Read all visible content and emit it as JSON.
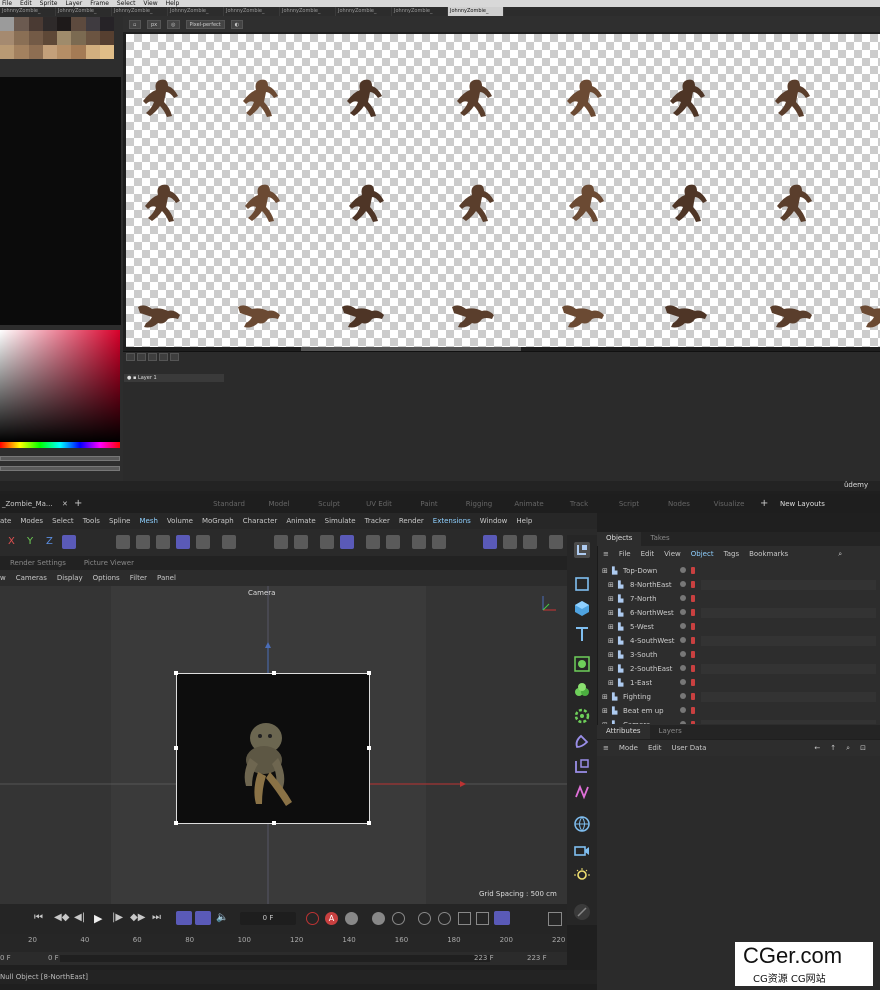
{
  "aseprite": {
    "menu": [
      "File",
      "Edit",
      "Sprite",
      "Layer",
      "Frame",
      "Select",
      "View",
      "Help"
    ],
    "tabs": [
      {
        "label": "JohnnyZombie_"
      },
      {
        "label": "JohnnyZombie_"
      },
      {
        "label": "JohnnyZombie_"
      },
      {
        "label": "JohnnyZombie_"
      },
      {
        "label": "JohnnyZombie_"
      },
      {
        "label": "JohnnyZombie_"
      },
      {
        "label": "JohnnyZombie_"
      },
      {
        "label": "JohnnyZombie_"
      },
      {
        "label": "JohnnyZombie_"
      }
    ],
    "toolbar": {
      "size": "px",
      "pixel_perfect": "Pixel-perfect"
    },
    "palette_colors": [
      "#9b9b9b",
      "#6b5a50",
      "#4a3a33",
      "#2e2a2a",
      "#1e1a1a",
      "#5d4a3e",
      "#3f3b40",
      "#262327",
      "#a58a70",
      "#8a6f55",
      "#735a46",
      "#5e4837",
      "#9f8b6b",
      "#7b6a51",
      "#6b5441",
      "#563f30",
      "#b99a74",
      "#a3815f",
      "#8e6e52",
      "#c4a07a",
      "#b58e66",
      "#a47b55",
      "#d2af7f",
      "#e0bd88"
    ],
    "layer": {
      "name": "Layer 1",
      "frame": "1"
    },
    "udemy": "ûdemy"
  },
  "c4d": {
    "doc_tab": "_Zombie_Ma...",
    "layouts": [
      "Standard",
      "Model",
      "Sculpt",
      "UV Edit",
      "Paint",
      "Rigging",
      "Animate",
      "Track",
      "Script",
      "Nodes",
      "Visualize"
    ],
    "new_layouts": "New Layouts",
    "menu": [
      "ate",
      "Modes",
      "Select",
      "Tools",
      "Spline",
      "Mesh",
      "Volume",
      "MoGraph",
      "Character",
      "Animate",
      "Simulate",
      "Tracker",
      "Render",
      "Extensions",
      "Window",
      "Help"
    ],
    "axes": [
      "X",
      "Y",
      "Z"
    ],
    "viewport_tabs": [
      "Render Settings",
      "Picture Viewer"
    ],
    "viewport_menu": [
      "w",
      "Cameras",
      "Display",
      "Options",
      "Filter",
      "Panel"
    ],
    "viewport_title": "Camera",
    "grid_spacing": "Grid Spacing : 500 cm",
    "current_frame": "0 F",
    "ruler_ticks": [
      "20",
      "40",
      "60",
      "80",
      "100",
      "120",
      "140",
      "160",
      "180",
      "200",
      "220"
    ],
    "frame_start": "0 F",
    "frame_start2": "0 F",
    "frame_end": "223 F",
    "frame_end2": "223 F",
    "status": "Null Object [8-NorthEast]",
    "objects_panel": {
      "tabs": [
        "Objects",
        "Takes"
      ],
      "menu": [
        "File",
        "Edit",
        "View",
        "Object",
        "Tags",
        "Bookmarks"
      ],
      "rows": [
        {
          "label": "Top-Down",
          "indent": 0
        },
        {
          "label": "8-NorthEast",
          "indent": 1
        },
        {
          "label": "7-North",
          "indent": 1
        },
        {
          "label": "6-NorthWest",
          "indent": 1
        },
        {
          "label": "5-West",
          "indent": 1
        },
        {
          "label": "4-SouthWest",
          "indent": 1
        },
        {
          "label": "3-South",
          "indent": 1
        },
        {
          "label": "2-SouthEast",
          "indent": 1
        },
        {
          "label": "1-East",
          "indent": 1
        },
        {
          "label": "Fighting",
          "indent": 0
        },
        {
          "label": "Beat em up",
          "indent": 0
        },
        {
          "label": "Camera",
          "indent": 0
        }
      ]
    },
    "attributes_panel": {
      "tabs": [
        "Attributes",
        "Layers"
      ],
      "menu": [
        "Mode",
        "Edit",
        "User Data"
      ]
    }
  },
  "watermark": {
    "big": "CGer.com",
    "small": "CG资源 CG网站"
  },
  "colors": {
    "accent": "#5a5ab8",
    "red": "#c94040",
    "checker": "#cccccc"
  }
}
